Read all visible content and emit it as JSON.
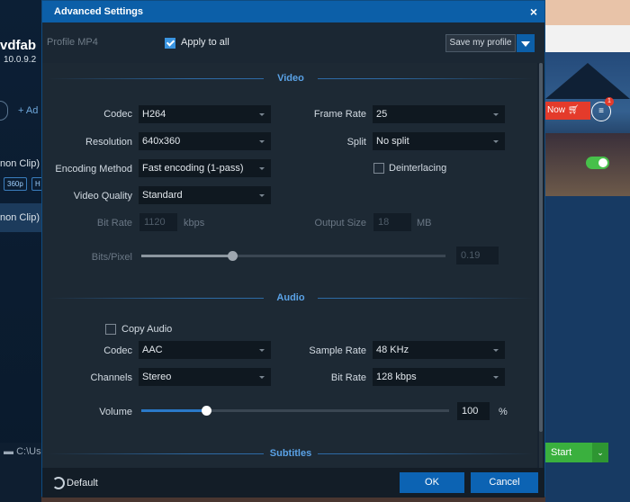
{
  "background_app": {
    "logo_text": "vdfab",
    "version": "10.0.9.2",
    "add_label": "Ad",
    "clip1": "non Clip) Gr",
    "chip1": "360p",
    "chip2": "H",
    "clip2": "non Clip) Gi",
    "path": "C:\\Us",
    "buy_label": "Now",
    "badge": "1",
    "start_label": "Start"
  },
  "dialog": {
    "title": "Advanced Settings",
    "close": "×",
    "profile_label": "Profile  MP4",
    "apply_all_label": "Apply to all",
    "apply_all_checked": true,
    "save_profile_label": "Save my profile"
  },
  "video": {
    "section_title": "Video",
    "codec_label": "Codec",
    "codec_value": "H264",
    "resolution_label": "Resolution",
    "resolution_value": "640x360",
    "encoding_label": "Encoding Method",
    "encoding_value": "Fast encoding (1-pass)",
    "quality_label": "Video Quality",
    "quality_value": "Standard",
    "bitrate_label": "Bit Rate",
    "bitrate_value": "1120",
    "bitrate_unit": "kbps",
    "framerate_label": "Frame Rate",
    "framerate_value": "25",
    "split_label": "Split",
    "split_value": "No split",
    "deinterlacing_label": "Deinterlacing",
    "deinterlacing_checked": false,
    "outputsize_label": "Output Size",
    "outputsize_value": "18",
    "outputsize_unit": "MB",
    "bitspixel_label": "Bits/Pixel",
    "bitspixel_value": "0.19",
    "bitspixel_slider_fraction": 0.3
  },
  "audio": {
    "section_title": "Audio",
    "copy_audio_label": "Copy Audio",
    "copy_audio_checked": false,
    "codec_label": "Codec",
    "codec_value": "AAC",
    "channels_label": "Channels",
    "channels_value": "Stereo",
    "samplerate_label": "Sample Rate",
    "samplerate_value": "48 KHz",
    "bitrate_label": "Bit Rate",
    "bitrate_value": "128 kbps",
    "volume_label": "Volume",
    "volume_value": "100",
    "volume_unit": "%",
    "volume_slider_fraction": 0.21
  },
  "subtitles": {
    "section_title": "Subtitles"
  },
  "footer": {
    "default_label": "Default",
    "ok_label": "OK",
    "cancel_label": "Cancel"
  },
  "colors": {
    "accent": "#0c63b3",
    "title_bar": "#0c5fa8",
    "slider_fill": "#2a79c8",
    "start_green": "#3ab03e"
  }
}
